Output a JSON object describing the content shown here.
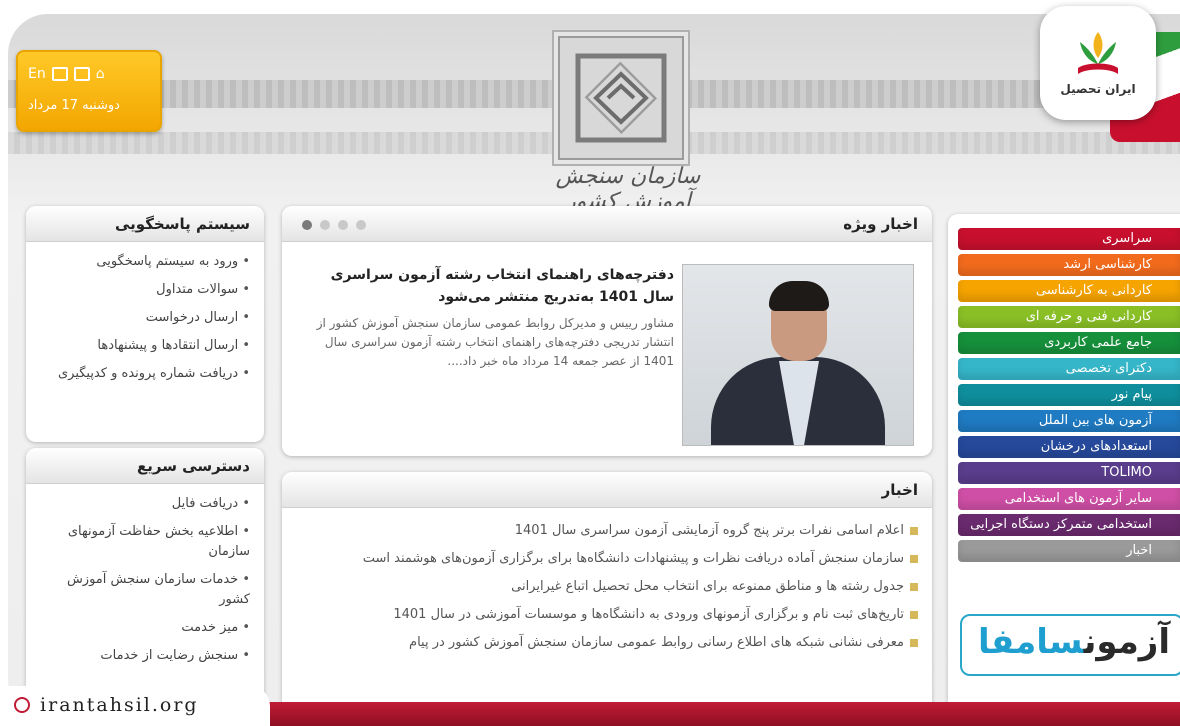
{
  "header": {
    "lang_link": "En",
    "date": "دوشنبه 17 مرداد",
    "org_title": "سازمان سنجش آموزش کشور"
  },
  "brand": {
    "name": "ایران تحصیل",
    "watermark": "irantahsil.org"
  },
  "support": {
    "title": "سیستم پاسخگویی",
    "items": [
      "ورود به سیستم پاسخگویی",
      "سوالات متداول",
      "ارسال درخواست",
      "ارسال انتقادها و پیشنهادها",
      "دریافت شماره پرونده و کدپیگیری"
    ]
  },
  "quick": {
    "title": "دسترسی سریع",
    "items": [
      "دریافت فایل",
      "اطلاعیه بخش حفاظت آزمونهای سازمان",
      "خدمات سازمان سنجش آموزش کشور",
      "میز خدمت",
      "سنجش رضایت از خدمات"
    ]
  },
  "featured": {
    "title": "اخبار ویژه",
    "headline": "دفترچه‌های راهنمای انتخاب رشته آزمون سراسری سال 1401 به‌تدریج منتشر می‌شود",
    "body": "مشاور رییس و مدیرکل روابط عمومی سازمان سنجش آموزش کشور از انتشار تدریجی دفترچه‌های راهنمای انتخاب رشته آزمون سراسری سال 1401 از عصر جمعه 14 مرداد ماه خبر داد...."
  },
  "news": {
    "title": "اخبار",
    "items": [
      "اعلام اسامی نفرات برتر پنج گروه آزمایشی آزمون سراسری سال 1401",
      "سازمان سنجش آماده دریافت نظرات و پیشنهادات دانشگاه‌ها برای برگزاری آزمون‌های هوشمند است",
      "جدول رشته ها و مناطق ممنوعه برای انتخاب محل تحصیل اتباع غیرایرانی",
      "تاریخ‌های ثبت نام و برگزاری آزمونهای ورودی به دانشگاه‌ها و موسسات آموزشی در سال 1401",
      "معرفی نشانی شبکه های اطلاع رسانی روابط عمومی سازمان سنجش آموزش کشور در پیام"
    ]
  },
  "menu": [
    {
      "label": "سراسری",
      "color": "#c8102e"
    },
    {
      "label": "کارشناسی ارشد",
      "color": "#f26b1d"
    },
    {
      "label": "کاردانی به کارشناسی",
      "color": "#f6a400"
    },
    {
      "label": "کاردانی فنی و حرفه ای",
      "color": "#8ac026"
    },
    {
      "label": "جامع علمی کاربردی",
      "color": "#16903b"
    },
    {
      "label": "دکترای تخصصی",
      "color": "#35b6c9"
    },
    {
      "label": "پیام نور",
      "color": "#0f8f9d"
    },
    {
      "label": "آزمون های بین الملل",
      "color": "#1f7bc2"
    },
    {
      "label": "استعدادهای درخشان",
      "color": "#26499b"
    },
    {
      "label": "TOLIMO",
      "color": "#5a3d8c"
    },
    {
      "label": "سایر آزمون های استخدامی",
      "color": "#cf4fa6"
    },
    {
      "label": "استخدامی متمرکز دستگاه اجرایی",
      "color": "#6a2a6e"
    },
    {
      "label": "اخبار",
      "color": "#9a9a9a"
    }
  ],
  "samfa": {
    "prefix": "آزمون",
    "name": "سامفا"
  }
}
